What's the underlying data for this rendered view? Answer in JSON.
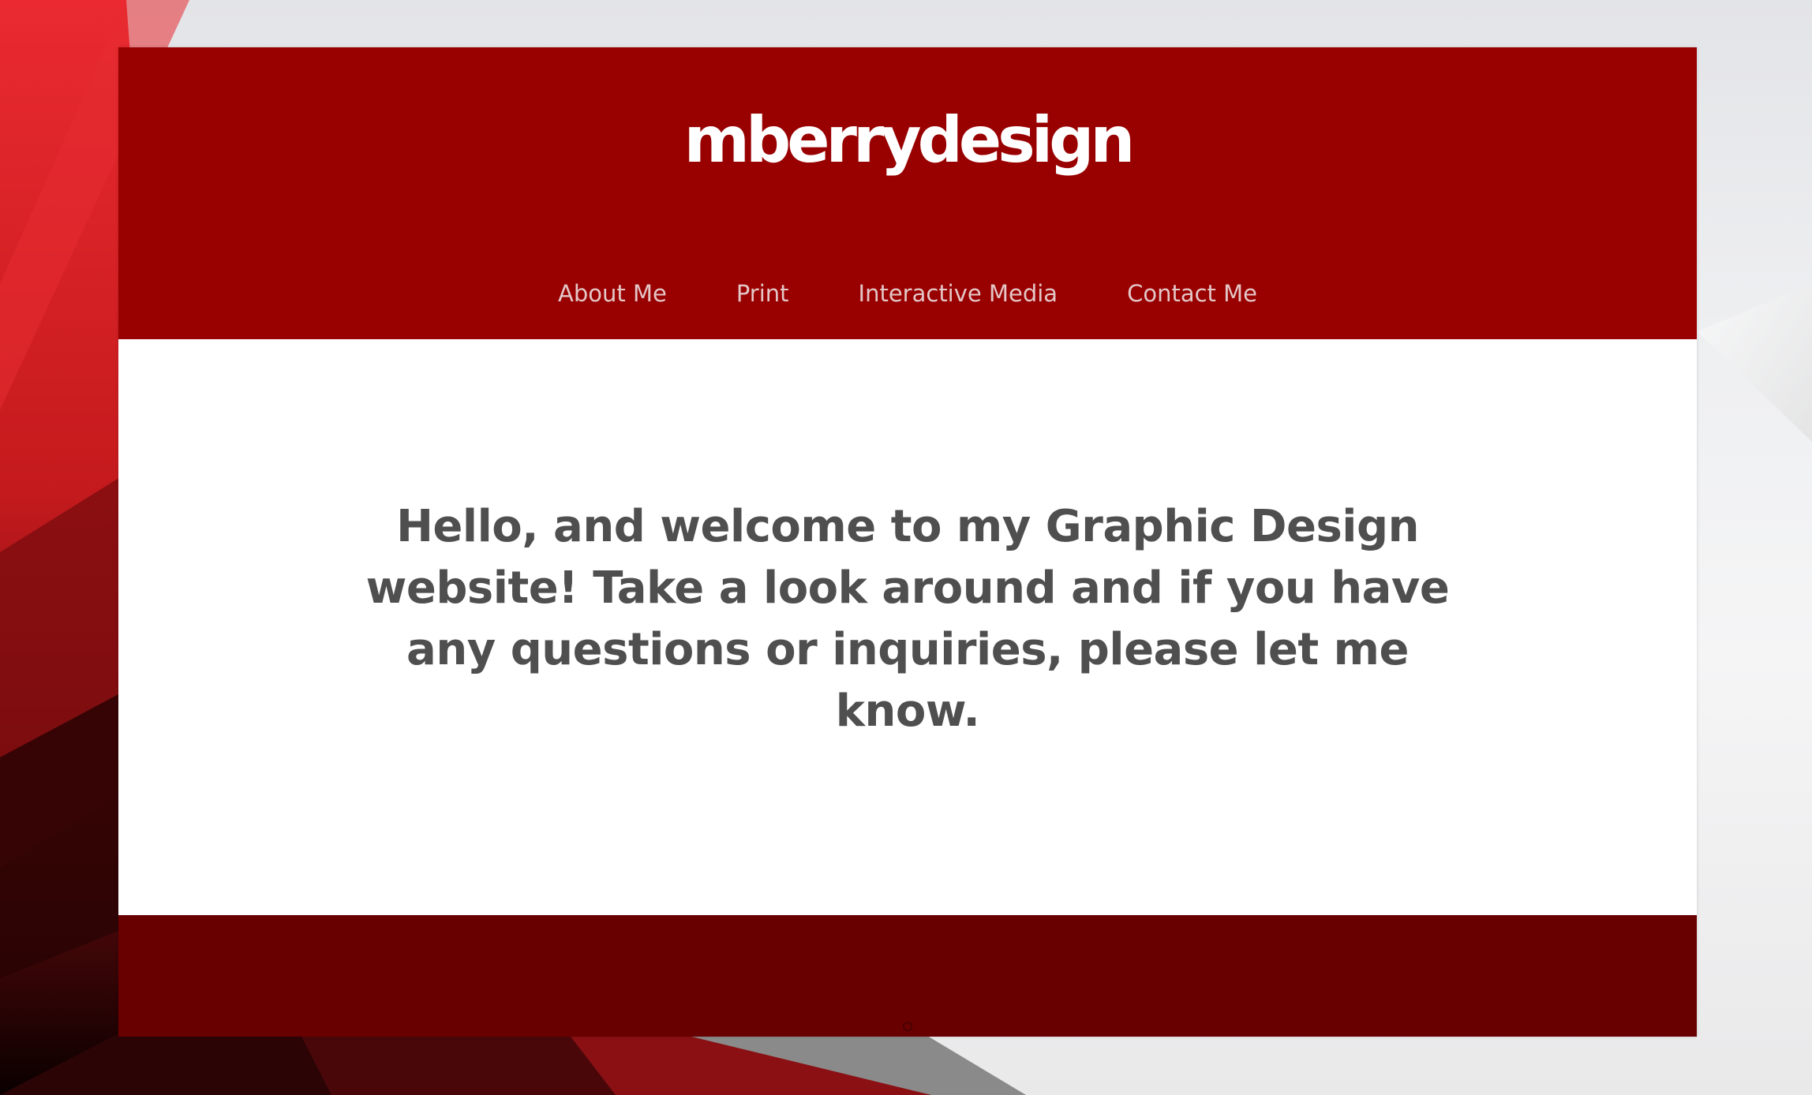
{
  "colors": {
    "header_bg": "#990000",
    "footer_bg": "#680000",
    "content_bg": "#ffffff",
    "logo_text": "#ffffff",
    "nav_text": "#e4c7c7",
    "body_text": "#4f4f4f"
  },
  "header": {
    "logo": "mberrydesign"
  },
  "nav": {
    "items": [
      {
        "label": "About Me"
      },
      {
        "label": "Print"
      },
      {
        "label": "Interactive Media"
      },
      {
        "label": "Contact Me"
      }
    ]
  },
  "main": {
    "welcome_line_1": "Hello, and welcome to my Graphic Design",
    "welcome_line_2": "website! Take a look around and if you have",
    "welcome_line_3": "any questions or inquiries, please let me know."
  },
  "footer": {
    "icon": "small-footer-icon"
  }
}
